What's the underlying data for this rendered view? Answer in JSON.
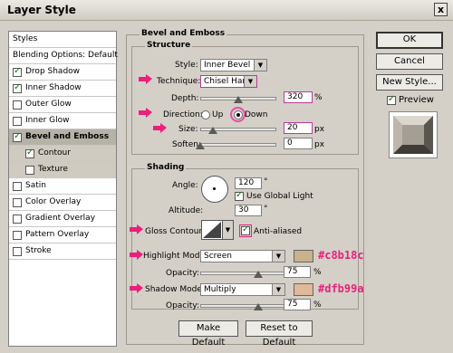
{
  "window": {
    "title": "Layer Style",
    "close_glyph": "x"
  },
  "styles_panel": {
    "items": [
      {
        "label": "Styles",
        "checked": null
      },
      {
        "label": "Blending Options: Default",
        "checked": null
      },
      {
        "label": "Drop Shadow",
        "checked": true
      },
      {
        "label": "Inner Shadow",
        "checked": true
      },
      {
        "label": "Outer Glow",
        "checked": false
      },
      {
        "label": "Inner Glow",
        "checked": false
      },
      {
        "label": "Bevel and Emboss",
        "checked": true
      },
      {
        "label": "Contour",
        "checked": true
      },
      {
        "label": "Texture",
        "checked": false
      },
      {
        "label": "Satin",
        "checked": false
      },
      {
        "label": "Color Overlay",
        "checked": false
      },
      {
        "label": "Gradient Overlay",
        "checked": false
      },
      {
        "label": "Pattern Overlay",
        "checked": false
      },
      {
        "label": "Stroke",
        "checked": false
      }
    ]
  },
  "bevel": {
    "group_title": "Bevel and Emboss",
    "structure_title": "Structure",
    "style_label": "Style:",
    "style_value": "Inner Bevel",
    "technique_label": "Technique:",
    "technique_value": "Chisel Hard",
    "depth_label": "Depth:",
    "depth_value": "320",
    "depth_unit": "%",
    "direction_label": "Direction:",
    "dir_up": "Up",
    "dir_down": "Down",
    "size_label": "Size:",
    "size_value": "20",
    "size_unit": "px",
    "soften_label": "Soften:",
    "soften_value": "0",
    "soften_unit": "px"
  },
  "shading": {
    "title": "Shading",
    "angle_label": "Angle:",
    "angle_value": "120",
    "deg": "°",
    "global_light_label": "Use Global Light",
    "altitude_label": "Altitude:",
    "altitude_value": "30",
    "gloss_label": "Gloss Contour:",
    "anti_alias_label": "Anti-aliased",
    "highlight_label": "Highlight Mode:",
    "highlight_value": "Screen",
    "highlight_color": "#c8b18c",
    "highlight_hex": "#c8b18c",
    "opacity_label": "Opacity:",
    "hl_opacity": "75",
    "pct": "%",
    "shadow_label": "Shadow Mode:",
    "shadow_value": "Multiply",
    "shadow_color": "#dfb99a",
    "shadow_hex": "#dfb99a",
    "sh_opacity": "75"
  },
  "buttons": {
    "ok": "OK",
    "cancel": "Cancel",
    "new_style": "New Style...",
    "preview": "Preview",
    "make_default": "Make Default",
    "reset_default": "Reset to Default"
  }
}
